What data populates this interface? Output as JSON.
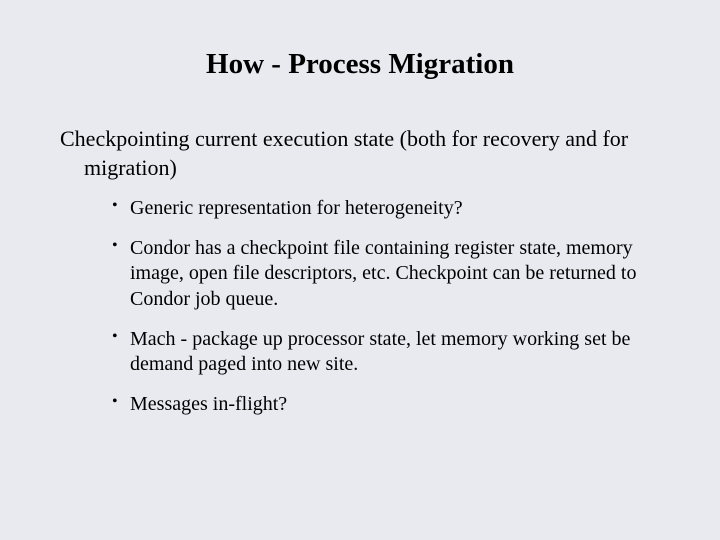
{
  "title": "How - Process Migration",
  "main_point": "Checkpointing current execution state (both for recovery and for migration)",
  "bullets": {
    "b0": "Generic representation for heterogeneity?",
    "b1": "Condor has a checkpoint file containing register state, memory image, open file descriptors, etc. Checkpoint can be returned to Condor job queue.",
    "b2": "Mach - package up processor state, let memory working set be demand paged into new site.",
    "b3": "Messages in-flight?"
  }
}
